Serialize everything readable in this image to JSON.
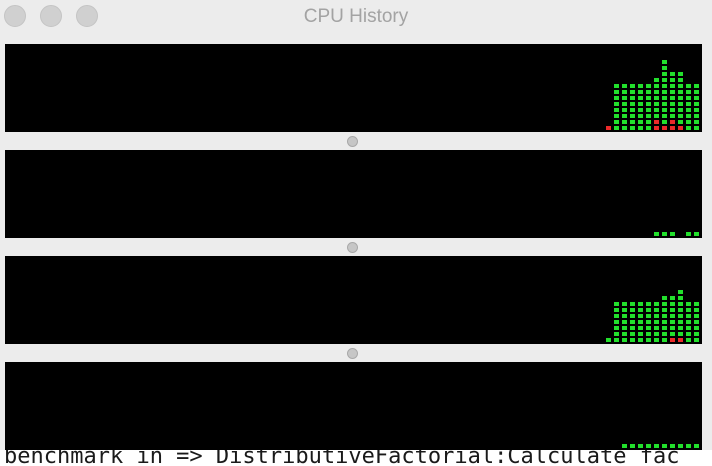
{
  "window": {
    "title": "CPU History",
    "buttons": [
      "close-button",
      "minimize-button",
      "zoom-button"
    ]
  },
  "colors": {
    "background": "#000000",
    "user_load": "#22e02c",
    "system_load": "#ec2a2a",
    "divider": "#c6c6c6"
  },
  "cpu_panels": [
    {
      "name": "cpu-1",
      "columns": [
        {
          "user": 0,
          "system": 1
        },
        {
          "user": 8,
          "system": 0
        },
        {
          "user": 8,
          "system": 0
        },
        {
          "user": 8,
          "system": 0
        },
        {
          "user": 8,
          "system": 0
        },
        {
          "user": 8,
          "system": 0
        },
        {
          "user": 7,
          "system": 2
        },
        {
          "user": 11,
          "system": 1
        },
        {
          "user": 8,
          "system": 2
        },
        {
          "user": 9,
          "system": 1
        },
        {
          "user": 8,
          "system": 0
        },
        {
          "user": 8,
          "system": 0
        }
      ]
    },
    {
      "name": "cpu-2",
      "columns": [
        {
          "user": 0,
          "system": 0
        },
        {
          "user": 0,
          "system": 0
        },
        {
          "user": 0,
          "system": 0
        },
        {
          "user": 0,
          "system": 0
        },
        {
          "user": 0,
          "system": 0
        },
        {
          "user": 0,
          "system": 0
        },
        {
          "user": 1,
          "system": 0
        },
        {
          "user": 1,
          "system": 0
        },
        {
          "user": 1,
          "system": 0
        },
        {
          "user": 0,
          "system": 0
        },
        {
          "user": 1,
          "system": 0
        },
        {
          "user": 1,
          "system": 0
        }
      ]
    },
    {
      "name": "cpu-3",
      "columns": [
        {
          "user": 1,
          "system": 0
        },
        {
          "user": 7,
          "system": 0
        },
        {
          "user": 7,
          "system": 0
        },
        {
          "user": 7,
          "system": 0
        },
        {
          "user": 7,
          "system": 0
        },
        {
          "user": 7,
          "system": 0
        },
        {
          "user": 7,
          "system": 0
        },
        {
          "user": 8,
          "system": 0
        },
        {
          "user": 7,
          "system": 1
        },
        {
          "user": 8,
          "system": 1
        },
        {
          "user": 7,
          "system": 0
        },
        {
          "user": 7,
          "system": 0
        }
      ]
    },
    {
      "name": "cpu-4",
      "columns": [
        {
          "user": 0,
          "system": 0
        },
        {
          "user": 0,
          "system": 0
        },
        {
          "user": 1,
          "system": 0
        },
        {
          "user": 1,
          "system": 0
        },
        {
          "user": 1,
          "system": 0
        },
        {
          "user": 1,
          "system": 0
        },
        {
          "user": 1,
          "system": 0
        },
        {
          "user": 1,
          "system": 0
        },
        {
          "user": 1,
          "system": 0
        },
        {
          "user": 1,
          "system": 0
        },
        {
          "user": 1,
          "system": 0
        },
        {
          "user": 1,
          "system": 0
        }
      ]
    }
  ],
  "background_terminal": {
    "partial_text": "benchmark in => DistributiveFactorial:Calculate fac"
  }
}
